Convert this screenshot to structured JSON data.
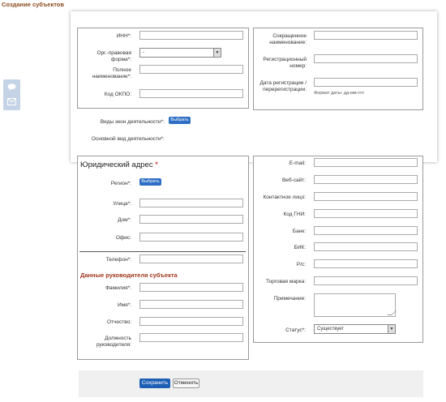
{
  "page": {
    "title": "Создание субъектов"
  },
  "icons": {
    "chat": "chat-bubble-icon",
    "mail": "envelope-icon"
  },
  "top_left": {
    "inn": "ИНН*:",
    "org_form": "Орг.-правовая форма*:",
    "org_form_value": "-",
    "full_name_1": "Полное",
    "full_name_2": "наименование*:",
    "okpo": "Код ОКПО:"
  },
  "top_right": {
    "short_name_1": "Сокращенное",
    "short_name_2": "наименование:",
    "reg_num_1": "Регистрационный",
    "reg_num_2": "номер:",
    "reg_date_1": "Дата регистрации /",
    "reg_date_2": "перерегистрации:",
    "date_hint": "Формат даты: дд-мм-гггг"
  },
  "activity": {
    "types_label": "Виды экон деятельности*:",
    "choose": "Выбрать",
    "main_label": "Основной вид деятельности*:"
  },
  "address": {
    "title": "Юридический адрес",
    "req": "*",
    "region": "Регион*:",
    "choose": "Выбрать",
    "street": "Улица*:",
    "house": "Дом*:",
    "office": "Офис:",
    "phone": "Телефон*:"
  },
  "head": {
    "title": "Данные руководителя субъекта",
    "lastname": "Фамилия*:",
    "firstname": "Имя*:",
    "patronymic": "Отчество:",
    "position_1": "Должность",
    "position_2": "руководителя:"
  },
  "contacts": {
    "email": "E-mail:",
    "website": "Веб-сайт:",
    "contact": "Контактное лицо:",
    "gni": "Код ГНИ:",
    "bank": "Банк:",
    "bik": "БИК:",
    "account": "Р/с:",
    "trademark": "Торговая марка:",
    "note": "Примечание:",
    "status": "Статус*:",
    "status_value": "Существует"
  },
  "footer": {
    "save": "Сохранить",
    "cancel": "Отменить"
  }
}
